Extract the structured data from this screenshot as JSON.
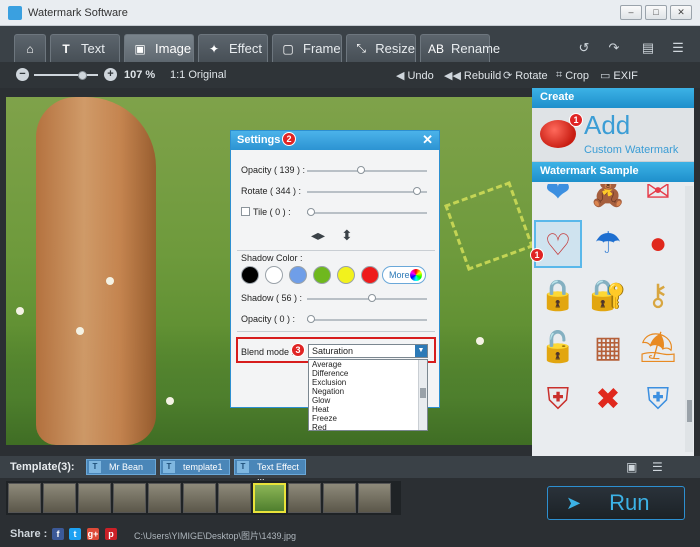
{
  "window": {
    "title": "Watermark Software",
    "controls": [
      "–",
      "□",
      "✕"
    ]
  },
  "tabs": [
    {
      "label": "",
      "icon": "home-icon",
      "active": false
    },
    {
      "label": "Text",
      "icon": "text-icon",
      "active": false
    },
    {
      "label": "Image",
      "icon": "image-icon",
      "active": true
    },
    {
      "label": "Effect",
      "icon": "effect-icon",
      "active": false
    },
    {
      "label": "Frame",
      "icon": "frame-icon",
      "active": false
    },
    {
      "label": "Resize",
      "icon": "resize-icon",
      "active": false
    },
    {
      "label": "Rename",
      "icon": "rename-icon",
      "active": false
    }
  ],
  "toolbar": {
    "zoom_value": "107 %",
    "original_label": "Original",
    "original_icon_text": "1:1",
    "undo_label": "Undo",
    "rebuild_label": "Rebuild",
    "rotate_label": "Rotate",
    "crop_label": "Crop",
    "exif_label": "EXIF",
    "zoom_level_fraction": 0.75
  },
  "create": {
    "header": "Create",
    "add_title": "Add",
    "add_subtitle": "Custom Watermark"
  },
  "samples": {
    "header": "Watermark Sample",
    "items": [
      "heart-icon",
      "love-bear-icon",
      "love-letter-icon",
      "heart-outline-icon",
      "umbrella-icon",
      "red-button-icon",
      "padlock-icon",
      "lock-icon",
      "key-icon",
      "silver-padlock-icon",
      "brick-wall-icon",
      "beach-umbrella-icon",
      "shield-red-icon",
      "red-x-icon",
      "windows-shield-icon"
    ],
    "selected_index": 3
  },
  "settings": {
    "title": "Settings",
    "opacity_label": "Opacity ( 139 ) :",
    "opacity_value": 139,
    "rotate_label": "Rotate ( 344 ) :",
    "rotate_value": 344,
    "tile_label": "Tile ( 0 ) :",
    "tile_value": 0,
    "shadow_color_label": "Shadow Color :",
    "shadow_colors": [
      "#000000",
      "#ffffff",
      "#6f9ee8",
      "#6fb81e",
      "#f2f21d",
      "#ee1b1b"
    ],
    "more_label": "More",
    "shadow_label": "Shadow ( 56 ) :",
    "shadow_value": 56,
    "shadow_opacity_label": "Opacity ( 0 ) :",
    "shadow_opacity_value": 0,
    "blend_label": "Blend mode :",
    "blend_value": "Saturation",
    "blend_options": [
      "Average",
      "Difference",
      "Exclusion",
      "Negation",
      "Glow",
      "Heat",
      "Freeze",
      "Red"
    ]
  },
  "badges": {
    "add": "1",
    "settings": "2",
    "blend": "3",
    "sample": "1"
  },
  "template": {
    "label": "Template(3):",
    "items": [
      "Mr Bean",
      "template1",
      "Text Effect ..."
    ]
  },
  "run_label": "Run",
  "share_label": "Share :",
  "social": [
    {
      "t": "f",
      "color": "#3b5998",
      "icon": "facebook-icon"
    },
    {
      "t": "t",
      "color": "#1da1f2",
      "icon": "twitter-icon"
    },
    {
      "t": "g+",
      "color": "#dd4b39",
      "icon": "google-plus-icon"
    },
    {
      "t": "p",
      "color": "#cb2027",
      "icon": "pinterest-icon"
    }
  ],
  "file_path": "C:\\Users\\YIMIGE\\Desktop\\图片\\1439.jpg",
  "colors": {
    "accent": "#2c93d2",
    "highlight": "#d71d1d",
    "badge": "#e02424"
  }
}
